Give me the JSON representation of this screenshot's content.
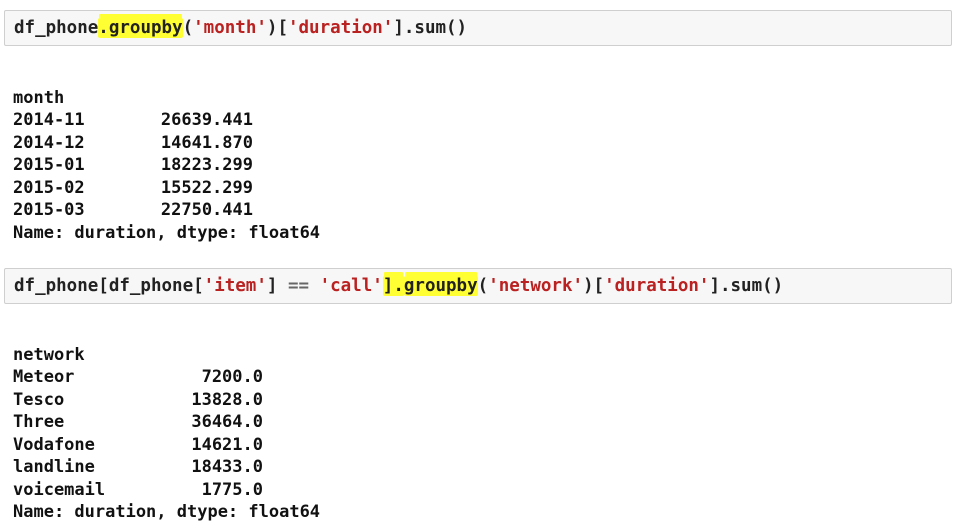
{
  "cell1": {
    "code": {
      "t0": "df_phone",
      "t1": ".groupby",
      "t2": "(",
      "t3": "'month'",
      "t4": ")[",
      "t5": "'duration'",
      "t6": "].sum()"
    },
    "output": {
      "index_name": "month",
      "rows": [
        {
          "key": "2014-11",
          "value": "26639.441"
        },
        {
          "key": "2014-12",
          "value": "14641.870"
        },
        {
          "key": "2015-01",
          "value": "18223.299"
        },
        {
          "key": "2015-02",
          "value": "15522.299"
        },
        {
          "key": "2015-03",
          "value": "22750.441"
        }
      ],
      "footer": "Name: duration, dtype: float64"
    }
  },
  "cell2": {
    "code": {
      "t0": "df_phone[df_phone[",
      "t1": "'item'",
      "t2": "] ",
      "t3": "==",
      "t4": " ",
      "t5": "'call'",
      "t6": "].",
      "t7": "groupby",
      "t8": "(",
      "t9": "'network'",
      "t10": ")[",
      "t11": "'duration'",
      "t12": "].sum()"
    },
    "output": {
      "index_name": "network",
      "rows": [
        {
          "key": "Meteor",
          "value": "7200.0"
        },
        {
          "key": "Tesco",
          "value": "13828.0"
        },
        {
          "key": "Three",
          "value": "36464.0"
        },
        {
          "key": "Vodafone",
          "value": "14621.0"
        },
        {
          "key": "landline",
          "value": "18433.0"
        },
        {
          "key": "voicemail",
          "value": "1775.0"
        }
      ],
      "footer": "Name: duration, dtype: float64"
    }
  },
  "colors": {
    "highlight": "#ffff33",
    "string": "#ba2121",
    "cell_background": "#f7f7f7",
    "cell_border": "#cfcfcf"
  }
}
